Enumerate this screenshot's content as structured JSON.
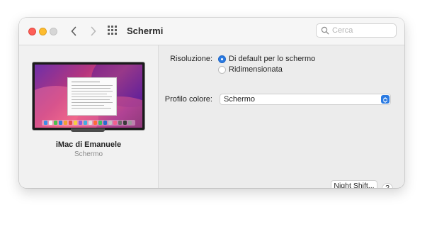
{
  "window": {
    "title": "Schermi",
    "search_placeholder": "Cerca",
    "traffic_colors": {
      "close": "#fe5f57",
      "minimize": "#febc2e",
      "zoom": "#d6d6d6"
    }
  },
  "sidebar": {
    "device_name": "iMac di Emanuele",
    "device_type": "Schermo"
  },
  "settings": {
    "resolution_label": "Risoluzione:",
    "resolution_options": [
      {
        "label": "Di default per lo schermo",
        "selected": true
      },
      {
        "label": "Ridimensionata",
        "selected": false
      }
    ],
    "color_profile_label": "Profilo colore:",
    "color_profile_value": "Schermo",
    "night_shift_button": "Night Shift...",
    "help_button": "?"
  },
  "colors": {
    "accent": "#2a7ae2"
  },
  "icons": [
    "back-chevron-icon",
    "forward-chevron-icon",
    "grid-icon",
    "search-icon",
    "select-arrows-icon"
  ]
}
